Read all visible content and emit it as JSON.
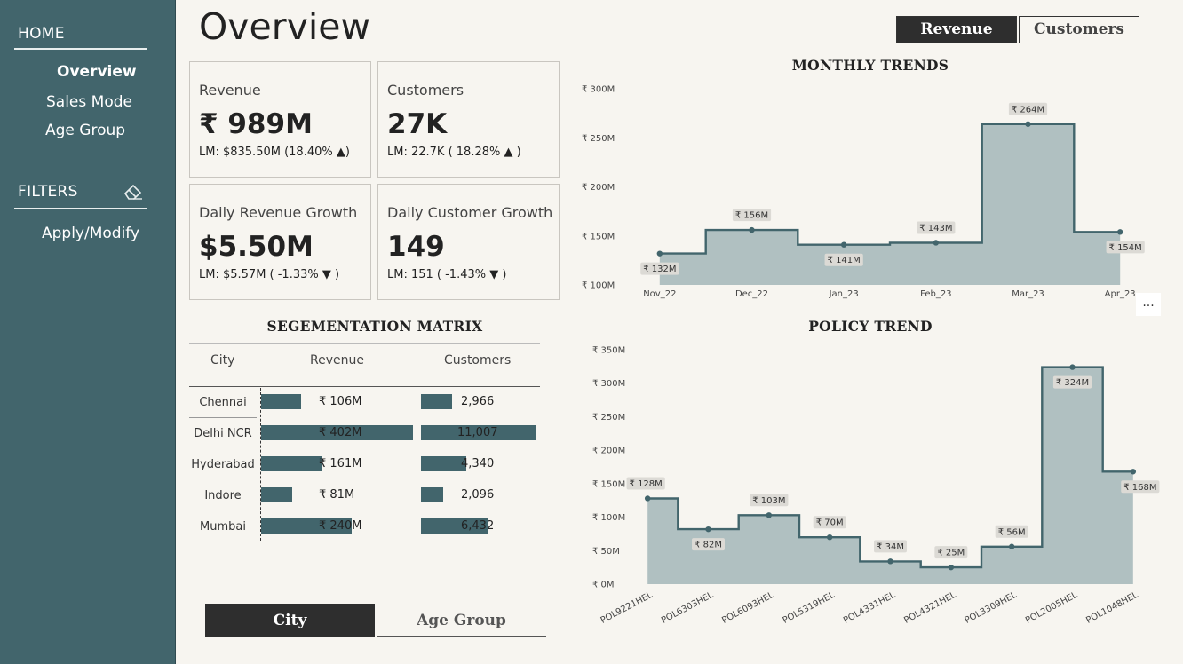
{
  "sidebar": {
    "home": "HOME",
    "nav": [
      "Overview",
      "Sales Mode",
      "Age Group"
    ],
    "filters": "FILTERS",
    "apply": "Apply/Modify"
  },
  "page_title": "Overview",
  "toggle": {
    "revenue": "Revenue",
    "customers": "Customers"
  },
  "kpis": [
    {
      "label": "Revenue",
      "value": "₹ 989M",
      "lm": "LM: $835.50M (18.40% ▲)"
    },
    {
      "label": "Customers",
      "value": "27K",
      "lm": "LM: 22.7K ( 18.28% ▲ )"
    },
    {
      "label": "Daily Revenue Growth",
      "value": "$5.50M",
      "lm": "LM: $5.57M ( -1.33% ▼ )"
    },
    {
      "label": "Daily Customer Growth",
      "value": "149",
      "lm": "LM: 151 ( -1.43% ▼ )"
    }
  ],
  "matrix": {
    "title": "SEGEMENTATION MATRIX",
    "headers": [
      "City",
      "Revenue",
      "Customers"
    ],
    "rows": [
      {
        "city": "Chennai",
        "revenue": "₹ 106M",
        "revenue_value": 106,
        "customers": "2,966",
        "customers_value": 2966
      },
      {
        "city": "Delhi NCR",
        "revenue": "₹ 402M",
        "revenue_value": 402,
        "customers": "11,007",
        "customers_value": 11007
      },
      {
        "city": "Hyderabad",
        "revenue": "₹ 161M",
        "revenue_value": 161,
        "customers": "4,340",
        "customers_value": 4340
      },
      {
        "city": "Indore",
        "revenue": "₹ 81M",
        "revenue_value": 81,
        "customers": "2,096",
        "customers_value": 2096
      },
      {
        "city": "Mumbai",
        "revenue": "₹ 240M",
        "revenue_value": 240,
        "customers": "6,432",
        "customers_value": 6432
      }
    ]
  },
  "bottom_tabs": {
    "city": "City",
    "age_group": "Age Group"
  },
  "more_label": "...",
  "colors": {
    "sidebar": "#42656c",
    "accent": "#42656c",
    "area_fill": "#b0c0c1",
    "background": "#f7f5f0"
  },
  "chart_data": [
    {
      "type": "area",
      "title": "MONTHLY TRENDS",
      "categories": [
        "Nov_22",
        "Dec_22",
        "Jan_23",
        "Feb_23",
        "Mar_23",
        "Apr_23"
      ],
      "values": [
        132,
        156,
        141,
        143,
        264,
        154
      ],
      "labels": [
        "₹ 132M",
        "₹ 156M",
        "₹ 141M",
        "₹ 143M",
        "₹ 264M",
        "₹ 154M"
      ],
      "yticks": [
        "₹ 100M",
        "₹ 150M",
        "₹ 200M",
        "₹ 250M",
        "₹ 300M"
      ],
      "ylim": [
        100,
        300
      ]
    },
    {
      "type": "area",
      "title": "POLICY TREND",
      "categories": [
        "POL9221HEL",
        "POL6303HEL",
        "POL6093HEL",
        "POL5319HEL",
        "POL4331HEL",
        "POL4321HEL",
        "POL3309HEL",
        "POL2005HEL",
        "POL1048HEL"
      ],
      "values": [
        128,
        82,
        103,
        70,
        34,
        25,
        56,
        324,
        168
      ],
      "labels": [
        "₹ 128M",
        "₹ 82M",
        "₹ 103M",
        "₹ 70M",
        "₹ 34M",
        "₹ 25M",
        "₹ 56M",
        "₹ 324M",
        "₹ 168M"
      ],
      "yticks": [
        "₹ 0M",
        "₹ 50M",
        "₹ 100M",
        "₹ 150M",
        "₹ 200M",
        "₹ 250M",
        "₹ 300M",
        "₹ 350M"
      ],
      "ylim": [
        0,
        350
      ]
    }
  ]
}
